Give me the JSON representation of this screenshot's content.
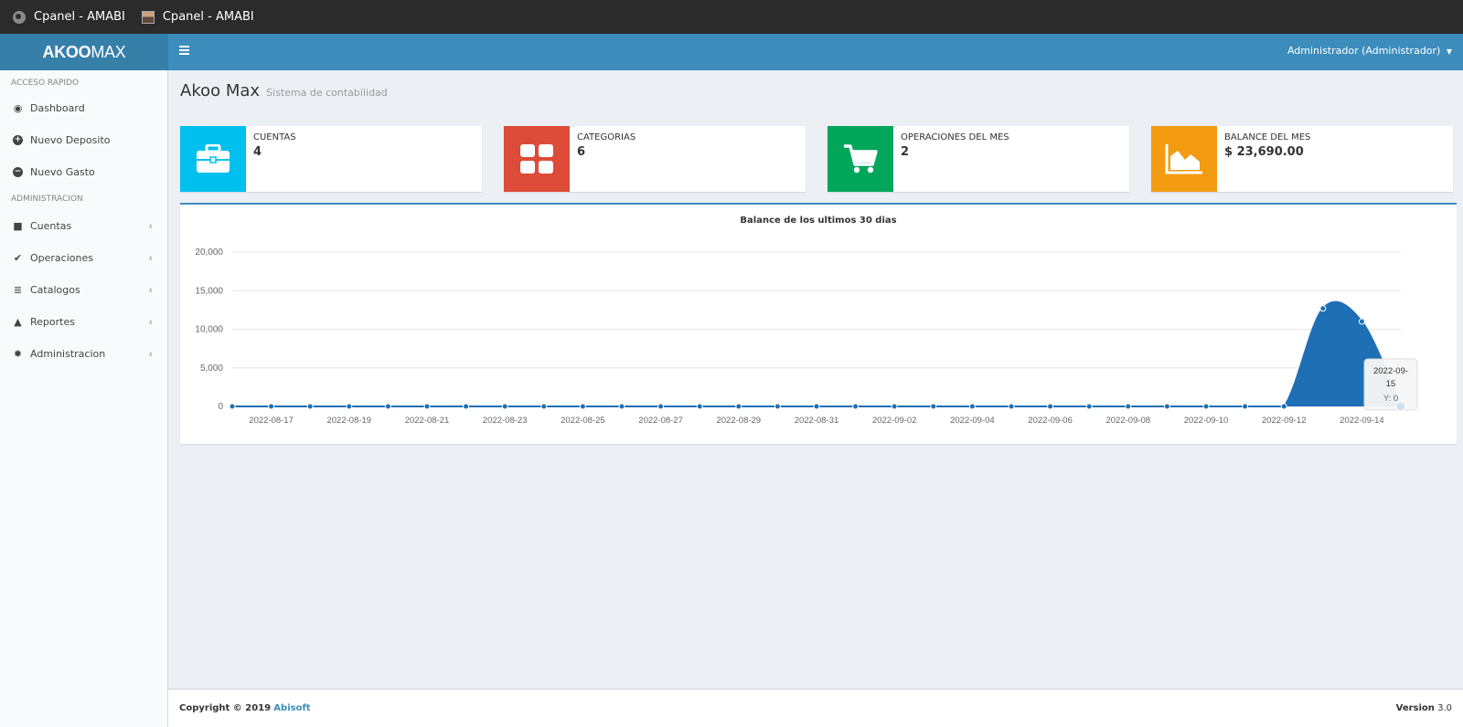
{
  "browser": {
    "tabs": [
      {
        "label": "Cpanel - AMABI",
        "icon": "globe-icon"
      },
      {
        "label": "Cpanel - AMABI",
        "icon": "user-avatar-icon"
      }
    ]
  },
  "header": {
    "logo_bold": "AKOO",
    "logo_light": "MAX",
    "user": "Administrador (Administrador)"
  },
  "sidebar": {
    "section1": "ACCESO RAPIDO",
    "quick": [
      {
        "label": "Dashboard",
        "icon": "dashboard-icon"
      },
      {
        "label": "Nuevo Deposito",
        "icon": "plus-circle-icon"
      },
      {
        "label": "Nuevo Gasto",
        "icon": "minus-circle-icon"
      }
    ],
    "section2": "ADMINISTRACION",
    "admin": [
      {
        "label": "Cuentas",
        "icon": "briefcase-icon"
      },
      {
        "label": "Operaciones",
        "icon": "check-icon"
      },
      {
        "label": "Catalogos",
        "icon": "database-icon"
      },
      {
        "label": "Reportes",
        "icon": "area-chart-icon"
      },
      {
        "label": "Administracion",
        "icon": "gear-icon"
      }
    ]
  },
  "page": {
    "title": "Akoo Max",
    "subtitle": "Sistema de contabilidad"
  },
  "infoboxes": [
    {
      "label": "CUENTAS",
      "value": "4",
      "color": "#00c0ef",
      "icon": "briefcase-icon"
    },
    {
      "label": "CATEGORIAS",
      "value": "6",
      "color": "#dd4b39",
      "icon": "grid-icon"
    },
    {
      "label": "OPERACIONES DEL MES",
      "value": "2",
      "color": "#00a65a",
      "icon": "cart-icon"
    },
    {
      "label": "BALANCE DEL MES",
      "value": "$ 23,690.00",
      "color": "#f39c12",
      "icon": "area-chart-icon"
    }
  ],
  "chart_data": {
    "type": "area",
    "title": "Balance de los ultimos 30 dias",
    "x": [
      "2022-08-16",
      "2022-08-17",
      "2022-08-18",
      "2022-08-19",
      "2022-08-20",
      "2022-08-21",
      "2022-08-22",
      "2022-08-23",
      "2022-08-24",
      "2022-08-25",
      "2022-08-26",
      "2022-08-27",
      "2022-08-28",
      "2022-08-29",
      "2022-08-30",
      "2022-08-31",
      "2022-09-01",
      "2022-09-02",
      "2022-09-03",
      "2022-09-04",
      "2022-09-05",
      "2022-09-06",
      "2022-09-07",
      "2022-09-08",
      "2022-09-09",
      "2022-09-10",
      "2022-09-11",
      "2022-09-12",
      "2022-09-13",
      "2022-09-14",
      "2022-09-15"
    ],
    "values": [
      0,
      0,
      0,
      0,
      0,
      0,
      0,
      0,
      0,
      0,
      0,
      0,
      0,
      0,
      0,
      0,
      0,
      0,
      0,
      0,
      0,
      0,
      0,
      0,
      0,
      0,
      0,
      0,
      12690,
      11000,
      0
    ],
    "x_tick_labels": [
      "2022-08-17",
      "2022-08-19",
      "2022-08-21",
      "2022-08-23",
      "2022-08-25",
      "2022-08-27",
      "2022-08-29",
      "2022-08-31",
      "2022-09-02",
      "2022-09-04",
      "2022-09-06",
      "2022-09-08",
      "2022-09-10",
      "2022-09-12",
      "2022-09-14"
    ],
    "y_ticks": [
      0,
      5000,
      10000,
      15000,
      20000
    ],
    "y_tick_labels": [
      "0",
      "5,000",
      "10,000",
      "15,000",
      "20,000"
    ],
    "ylim": [
      0,
      20000
    ],
    "grid": true,
    "color": "#1f6fb5",
    "tooltip": {
      "date": "2022-09-15",
      "text": "Y: 0"
    }
  },
  "footer": {
    "copyright": "Copyright © 2019",
    "company": "Abisoft",
    "version_label": "Version",
    "version": "3.0"
  }
}
